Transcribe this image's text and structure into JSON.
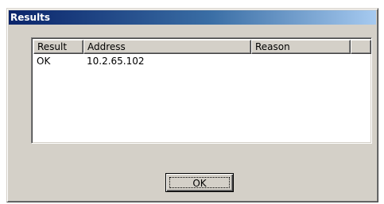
{
  "window": {
    "title": "Results"
  },
  "list": {
    "columns": [
      "Result",
      "Address",
      "Reason",
      ""
    ],
    "rows": [
      {
        "result": "OK",
        "address": "10.2.65.102",
        "reason": ""
      }
    ]
  },
  "buttons": {
    "ok_label": "OK"
  },
  "colors": {
    "titlebar_start": "#0a246a",
    "titlebar_end": "#a6caf0",
    "face": "#d4d0c8"
  }
}
